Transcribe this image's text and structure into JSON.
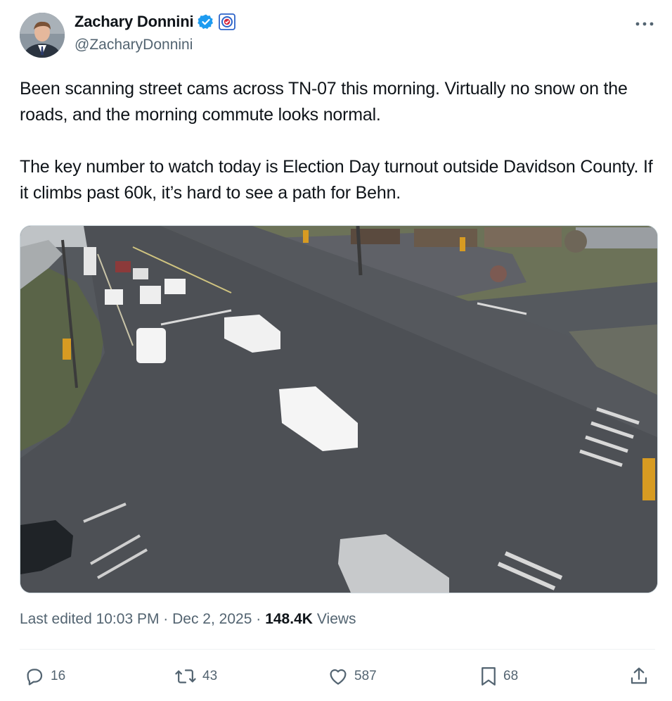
{
  "author": {
    "display_name": "Zachary Donnini",
    "handle": "@ZacharyDonnini",
    "avatar_icon": "profile-photo",
    "verified_color": "#1d9bf0",
    "affiliation_color": "#2e64c9"
  },
  "tweet": {
    "paragraphs": [
      "Been scanning street cams across TN-07 this morning. Virtually no snow on the roads, and the morning commute looks normal.",
      "The key number to watch today is Election Day turnout outside Davidson County. If it climbs past 60k, it’s hard to see a path for Behn."
    ]
  },
  "meta": {
    "edited": "Last edited 10:03 PM · Dec 2, 2025 ·",
    "views_count": "148.4K",
    "views_label": "Views"
  },
  "actions": {
    "replies": "16",
    "reposts": "43",
    "likes": "587",
    "bookmarks": "68"
  },
  "icons": [
    "more-icon",
    "verified-badge-icon",
    "affiliation-badge-icon",
    "reply-icon",
    "repost-icon",
    "like-icon",
    "bookmark-icon",
    "share-icon"
  ]
}
